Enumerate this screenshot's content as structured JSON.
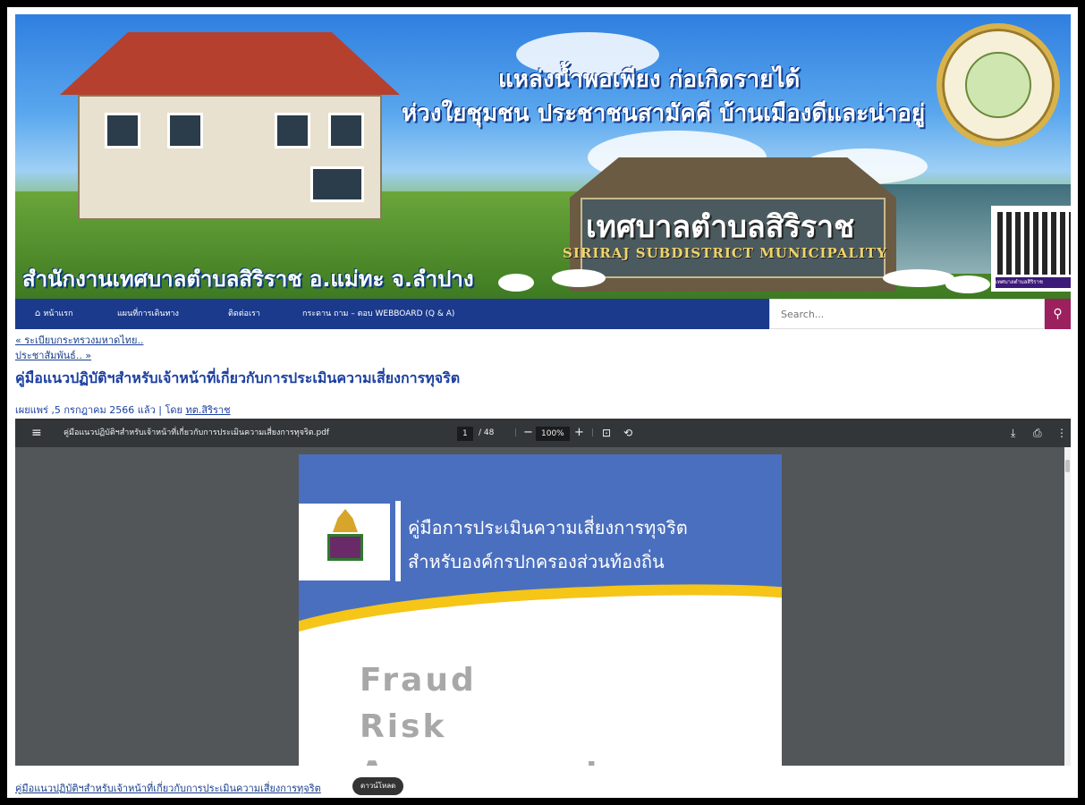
{
  "banner": {
    "slogan_line1": "แหล่งน้ำพอเพียง ก่อเกิดรายได้",
    "slogan_line2": "ห่วงใยชุมชน ประชาชนสามัคคี บ้านเมืองดีและน่าอยู่",
    "municipality_th": "เทศบาลตำบลสิริราช",
    "municipality_en": "SIRIRAJ SUBDISTRICT MUNICIPALITY",
    "office": "สำนักงานเทศบาลตำบลสิริราช อ.แม่ทะ จ.ลำปาง",
    "qr_label": "เทศบาลตำบลสิริราช"
  },
  "nav": {
    "items": [
      {
        "label": "หน้าแรก",
        "icon": "home-icon"
      },
      {
        "label": "แผนที่การเดินทาง"
      },
      {
        "label": "ติดต่อเรา"
      },
      {
        "label": "กระดาน ถาม – ตอบ WEBBOARD (Q & A)"
      }
    ],
    "search_placeholder": "Search...",
    "search_icon": "search-icon"
  },
  "post": {
    "prev_link": "« ระเบียบกระทรวงมหาดไทย..",
    "next_link": "ประชาสัมพันธ์.. »",
    "title": "คู่มือแนวปฏิบัติฯสำหรับเจ้าหน้าที่เกี่ยวกับการประเมินความเสี่ยงการทุจริต",
    "meta_prefix": "เผยแพร่ ,5 กรกฎาคม 2566 แล้ว | โดย ",
    "author": "ทต.สิริราช"
  },
  "pdf": {
    "menu_icon": "≡",
    "filename": "คู่มือแนวปฏิบัติฯสำหรับเจ้าหน้าที่เกี่ยวกับการประเมินความเสี่ยงการทุจริต.pdf",
    "current_page": "1",
    "total_pages": "/ 48",
    "zoom": "100%",
    "zoom_out": "−",
    "zoom_in": "+",
    "fit_icon": "⊡",
    "rotate_icon": "⟲",
    "download_icon": "⤓",
    "print_icon": "⎙",
    "more_icon": "⋮",
    "page_heading1": "คู่มือการประเมินความเสี่ยงการทุจริต",
    "page_heading2": "สำหรับองค์กรปกครองส่วนท้องถิ่น",
    "page_big1": "Fraud",
    "page_big2": "Risk",
    "page_big3": "Assessment"
  },
  "footer": {
    "file_link": "คู่มือแนวปฏิบัติฯสำหรับเจ้าหน้าที่เกี่ยวกับการประเมินความเสี่ยงการทุจริต",
    "download_label": "ดาวน์โหลด"
  },
  "colors": {
    "nav_bg": "#1b3a8c",
    "search_button": "#9c1f5e",
    "title_blue": "#1b3fa0",
    "pdf_toolbar": "#323639",
    "pdf_bg": "#525659"
  }
}
